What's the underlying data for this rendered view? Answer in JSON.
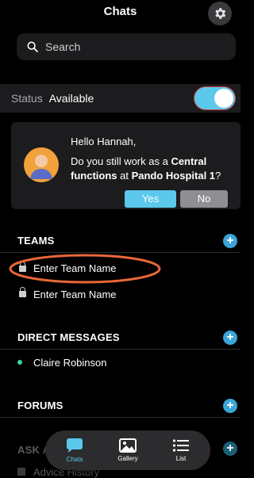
{
  "header": {
    "title": "Chats"
  },
  "search": {
    "placeholder": "Search"
  },
  "status": {
    "label": "Status",
    "value": "Available",
    "toggle_on": true
  },
  "prompt": {
    "greeting": "Hello Hannah,",
    "question_prefix": "Do you still work as a ",
    "role": "Central functions",
    "question_mid": " at ",
    "org": "Pando Hospital 1",
    "question_suffix": "?",
    "yes_label": "Yes",
    "no_label": "No"
  },
  "sections": {
    "teams": {
      "title": "TEAMS",
      "items": [
        "Enter Team Name",
        "Enter Team Name"
      ]
    },
    "direct_messages": {
      "title": "DIRECT MESSAGES",
      "items": [
        "Claire Robinson"
      ]
    },
    "forums": {
      "title": "FORUMS"
    },
    "ask": {
      "title": "ASK A",
      "items": [
        "Advice History"
      ]
    }
  },
  "tabbar": {
    "tabs": [
      {
        "label": "Chats",
        "active": true
      },
      {
        "label": "Gallery",
        "active": false
      },
      {
        "label": "List",
        "active": false
      }
    ]
  },
  "colors": {
    "accent": "#5bc8ec",
    "highlight_ring": "#e8673a",
    "online": "#3ed0a4"
  }
}
